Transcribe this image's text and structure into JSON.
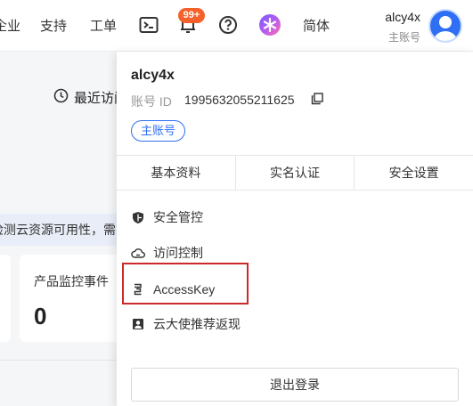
{
  "topnav": {
    "items": [
      {
        "label": "企业"
      },
      {
        "label": "支持"
      },
      {
        "label": "工单"
      }
    ],
    "notification_badge": "99+",
    "language": "简体",
    "username": "alcy4x",
    "account_type": "主账号"
  },
  "background": {
    "recent_label": "最近访问",
    "banner_text": "检测云资源可用性，需",
    "card": {
      "title": "产品监控事件",
      "value": "0"
    }
  },
  "dropdown": {
    "username": "alcy4x",
    "id_label": "账号 ID",
    "id_value": "1995632055211625",
    "account_badge": "主账号",
    "tabs": [
      {
        "label": "基本资料"
      },
      {
        "label": "实名认证"
      },
      {
        "label": "安全设置"
      }
    ],
    "menu": [
      {
        "label": "安全管控",
        "icon": "shield-icon"
      },
      {
        "label": "访问控制",
        "icon": "cloud-icon"
      },
      {
        "label": "AccessKey",
        "icon": "key-icon"
      },
      {
        "label": "云大使推荐返现",
        "icon": "portrait-icon"
      }
    ],
    "logout_label": "退出登录"
  },
  "colors": {
    "accent": "#2f6ff3",
    "badge": "#f4612b",
    "highlight": "#cc2a2a"
  }
}
